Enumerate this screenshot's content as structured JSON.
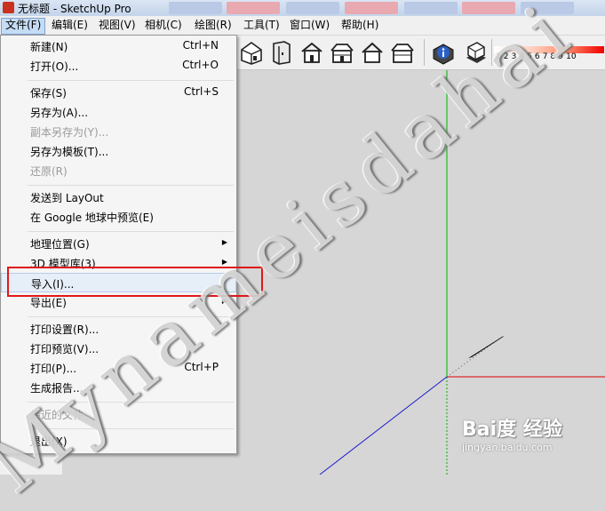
{
  "window": {
    "title": "无标题 - SketchUp Pro"
  },
  "menubar": {
    "items": [
      {
        "label": "文件(F)"
      },
      {
        "label": "编辑(E)"
      },
      {
        "label": "视图(V)"
      },
      {
        "label": "相机(C)"
      },
      {
        "label": "绘图(R)"
      },
      {
        "label": "工具(T)"
      },
      {
        "label": "窗口(W)"
      },
      {
        "label": "帮助(H)"
      }
    ]
  },
  "file_menu": {
    "new": {
      "label": "新建(N)",
      "shortcut": "Ctrl+N"
    },
    "open": {
      "label": "打开(O)...",
      "shortcut": "Ctrl+O"
    },
    "save": {
      "label": "保存(S)",
      "shortcut": "Ctrl+S"
    },
    "save_as": {
      "label": "另存为(A)..."
    },
    "save_copy_as": {
      "label": "副本另存为(Y)..."
    },
    "save_as_template": {
      "label": "另存为模板(T)..."
    },
    "revert": {
      "label": "还原(R)"
    },
    "send_to_layout": {
      "label": "发送到 LayOut"
    },
    "preview_google_earth": {
      "label": "在 Google 地球中预览(E)"
    },
    "geo_location": {
      "label": "地理位置(G)"
    },
    "warehouse_3d": {
      "label": "3D 模型库(3)"
    },
    "import": {
      "label": "导入(I)..."
    },
    "export": {
      "label": "导出(E)"
    },
    "print_setup": {
      "label": "打印设置(R)..."
    },
    "print_preview": {
      "label": "打印预览(V)..."
    },
    "print": {
      "label": "打印(P)...",
      "shortcut": "Ctrl+P"
    },
    "generate_report": {
      "label": "生成报告..."
    },
    "recent_files": {
      "label": "最近的文件"
    },
    "exit": {
      "label": "退出(X)"
    }
  },
  "toolbar": {
    "icons": [
      "house-iso-icon",
      "door-front-icon",
      "house-front-icon",
      "house-right-icon",
      "house-back-icon",
      "house-left-icon",
      "info-sphere-icon",
      "shadow-box-icon"
    ],
    "legend_numbers": "1 2 3 4 5 6 7 8 9 10"
  },
  "watermark": {
    "text": "Mynameisdahai"
  },
  "brand": {
    "main": "Bai度 经验",
    "sub": "jingyan.baidu.com"
  },
  "colors": {
    "axis_green": "#00b000",
    "axis_red": "#e00000",
    "axis_blue": "#1a1acc",
    "highlight_box": "#e01818"
  }
}
